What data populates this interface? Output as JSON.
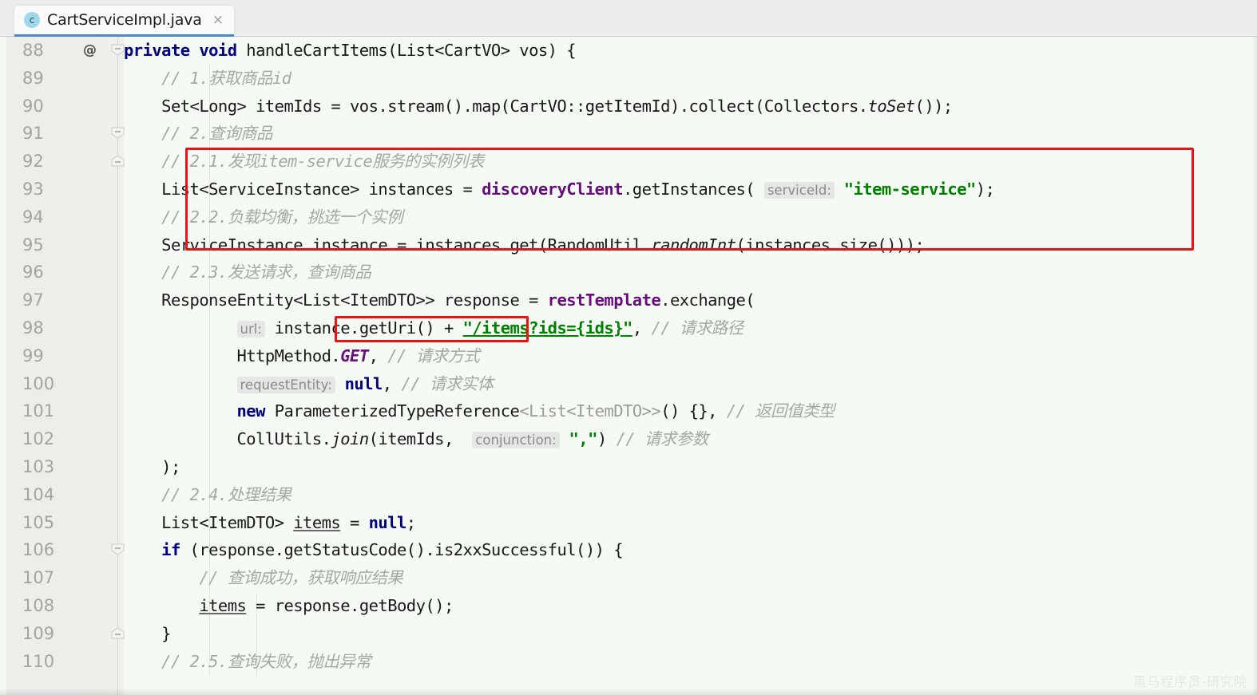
{
  "tab": {
    "icon": "java-class-icon",
    "label": "CartServiceImpl.java",
    "close": "×"
  },
  "editor": {
    "first_line": 88,
    "watermark": "黑马程序员-研究院",
    "annotation_marker": "@",
    "colors": {
      "keyword": "#000080",
      "comment": "#a2aaa2",
      "string": "#008000",
      "field": "#660e7a",
      "static": "#660e7a",
      "highlight_box": "#ee1111",
      "background": "#f6faf4",
      "gutter": "#eceeea",
      "tab_active_underline": "#4a86c8"
    },
    "lines": [
      {
        "n": 88,
        "fold": "start",
        "at": true,
        "text": "private void handleCartItems(List<CartVO> vos) {"
      },
      {
        "n": 89,
        "fold": null,
        "at": false,
        "text": "    // 1.获取商品id"
      },
      {
        "n": 90,
        "fold": null,
        "at": false,
        "text": "    Set<Long> itemIds = vos.stream().map(CartVO::getItemId).collect(Collectors.toSet());"
      },
      {
        "n": 91,
        "fold": "start",
        "at": false,
        "text": "    // 2.查询商品"
      },
      {
        "n": 92,
        "fold": "end",
        "at": false,
        "text": "    // 2.1.发现item-service服务的实例列表"
      },
      {
        "n": 93,
        "fold": null,
        "at": false,
        "text": "    List<ServiceInstance> instances = discoveryClient.getInstances( serviceId: \"item-service\");"
      },
      {
        "n": 94,
        "fold": null,
        "at": false,
        "text": "    // 2.2.负载均衡，挑选一个实例"
      },
      {
        "n": 95,
        "fold": null,
        "at": false,
        "text": "    ServiceInstance instance = instances.get(RandomUtil.randomInt(instances.size()));"
      },
      {
        "n": 96,
        "fold": null,
        "at": false,
        "text": "    // 2.3.发送请求，查询商品"
      },
      {
        "n": 97,
        "fold": null,
        "at": false,
        "text": "    ResponseEntity<List<ItemDTO>> response = restTemplate.exchange("
      },
      {
        "n": 98,
        "fold": null,
        "at": false,
        "text": "            url: instance.getUri() + \"/items?ids={ids}\", // 请求路径"
      },
      {
        "n": 99,
        "fold": null,
        "at": false,
        "text": "            HttpMethod.GET, // 请求方式"
      },
      {
        "n": 100,
        "fold": null,
        "at": false,
        "text": "            requestEntity: null, // 请求实体"
      },
      {
        "n": 101,
        "fold": null,
        "at": false,
        "text": "            new ParameterizedTypeReference<List<ItemDTO>>() {}, // 返回值类型"
      },
      {
        "n": 102,
        "fold": null,
        "at": false,
        "text": "            CollUtils.join(itemIds,  conjunction: \",\") // 请求参数"
      },
      {
        "n": 103,
        "fold": null,
        "at": false,
        "text": "    );"
      },
      {
        "n": 104,
        "fold": null,
        "at": false,
        "text": "    // 2.4.处理结果"
      },
      {
        "n": 105,
        "fold": null,
        "at": false,
        "text": "    List<ItemDTO> items = null;"
      },
      {
        "n": 106,
        "fold": "start",
        "at": false,
        "text": "    if (response.getStatusCode().is2xxSuccessful()) {"
      },
      {
        "n": 107,
        "fold": null,
        "at": false,
        "text": "        // 查询成功，获取响应结果"
      },
      {
        "n": 108,
        "fold": null,
        "at": false,
        "text": "        items = response.getBody();"
      },
      {
        "n": 109,
        "fold": "end",
        "at": false,
        "text": "    }"
      },
      {
        "n": 110,
        "fold": null,
        "at": false,
        "text": "    // 2.5.查询失败，抛出异常"
      }
    ],
    "inlay_hints": [
      {
        "line": 93,
        "text": "serviceId:"
      },
      {
        "line": 98,
        "text": "url:"
      },
      {
        "line": 100,
        "text": "requestEntity:"
      },
      {
        "line": 102,
        "text": "conjunction:"
      }
    ],
    "highlights": [
      {
        "name": "discovery-client-block",
        "lines": "92-95"
      },
      {
        "name": "instance-get-uri",
        "lines": "98"
      }
    ]
  }
}
